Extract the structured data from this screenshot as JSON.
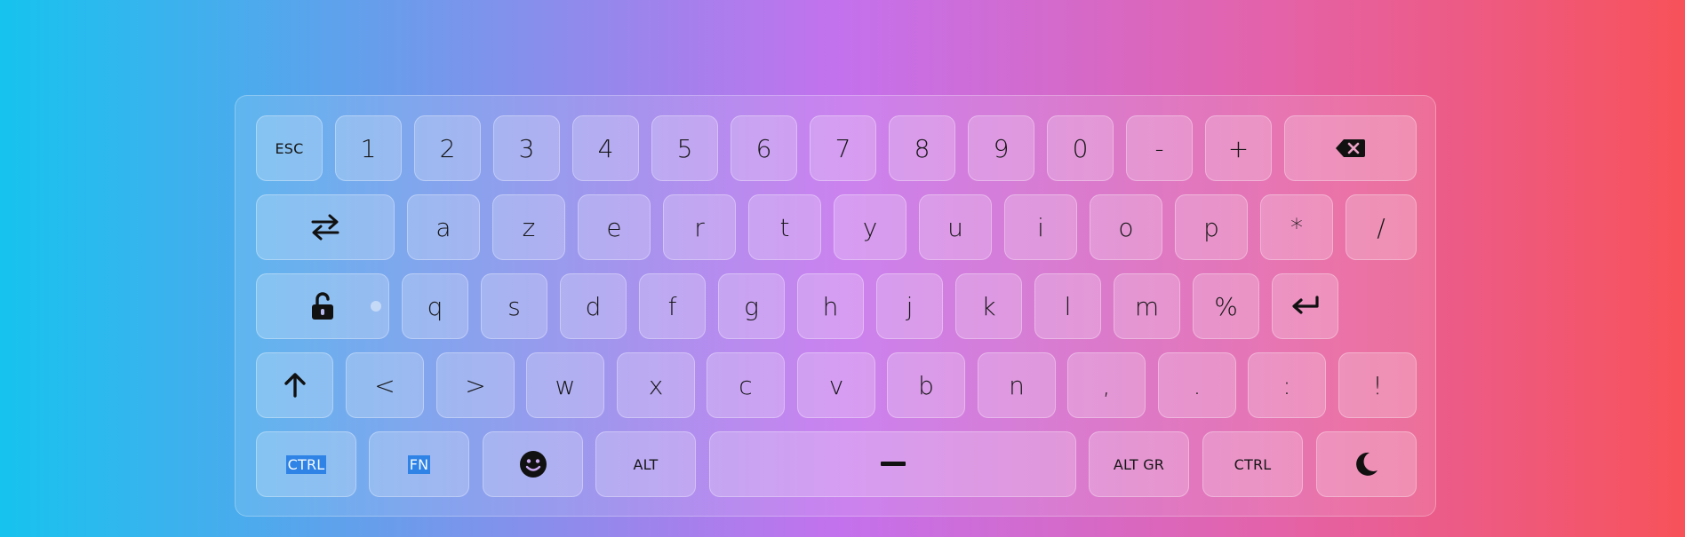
{
  "keyboard": {
    "row1": {
      "esc": "ESC",
      "digits": [
        "1",
        "2",
        "3",
        "4",
        "5",
        "6",
        "7",
        "8",
        "9",
        "0"
      ],
      "minus": "-",
      "plus": "+",
      "backspace_icon": "backspace-icon"
    },
    "row2": {
      "tab_icon": "arrows-left-right-icon",
      "letters": [
        "a",
        "z",
        "e",
        "r",
        "t",
        "y",
        "u",
        "i",
        "o",
        "p"
      ],
      "star": "*",
      "slash": "/"
    },
    "row3": {
      "caps_icon": "unlock-icon",
      "letters": [
        "q",
        "s",
        "d",
        "f",
        "g",
        "h",
        "j",
        "k",
        "l",
        "m"
      ],
      "percent": "%",
      "enter_icon": "enter-icon"
    },
    "row4": {
      "shift_icon": "arrow-up-icon",
      "symbols": [
        "<",
        ">",
        "w",
        "x",
        "c",
        "v",
        "b",
        "n",
        ",",
        ".",
        ":",
        "!"
      ]
    },
    "row5": {
      "ctrl_left": "CTRL",
      "fn": "FN",
      "emoji_icon": "smiley-icon",
      "alt": "ALT",
      "space_icon": "dash-icon",
      "alt_gr": "ALT GR",
      "ctrl_right": "CTRL",
      "moon_icon": "moon-icon"
    }
  }
}
